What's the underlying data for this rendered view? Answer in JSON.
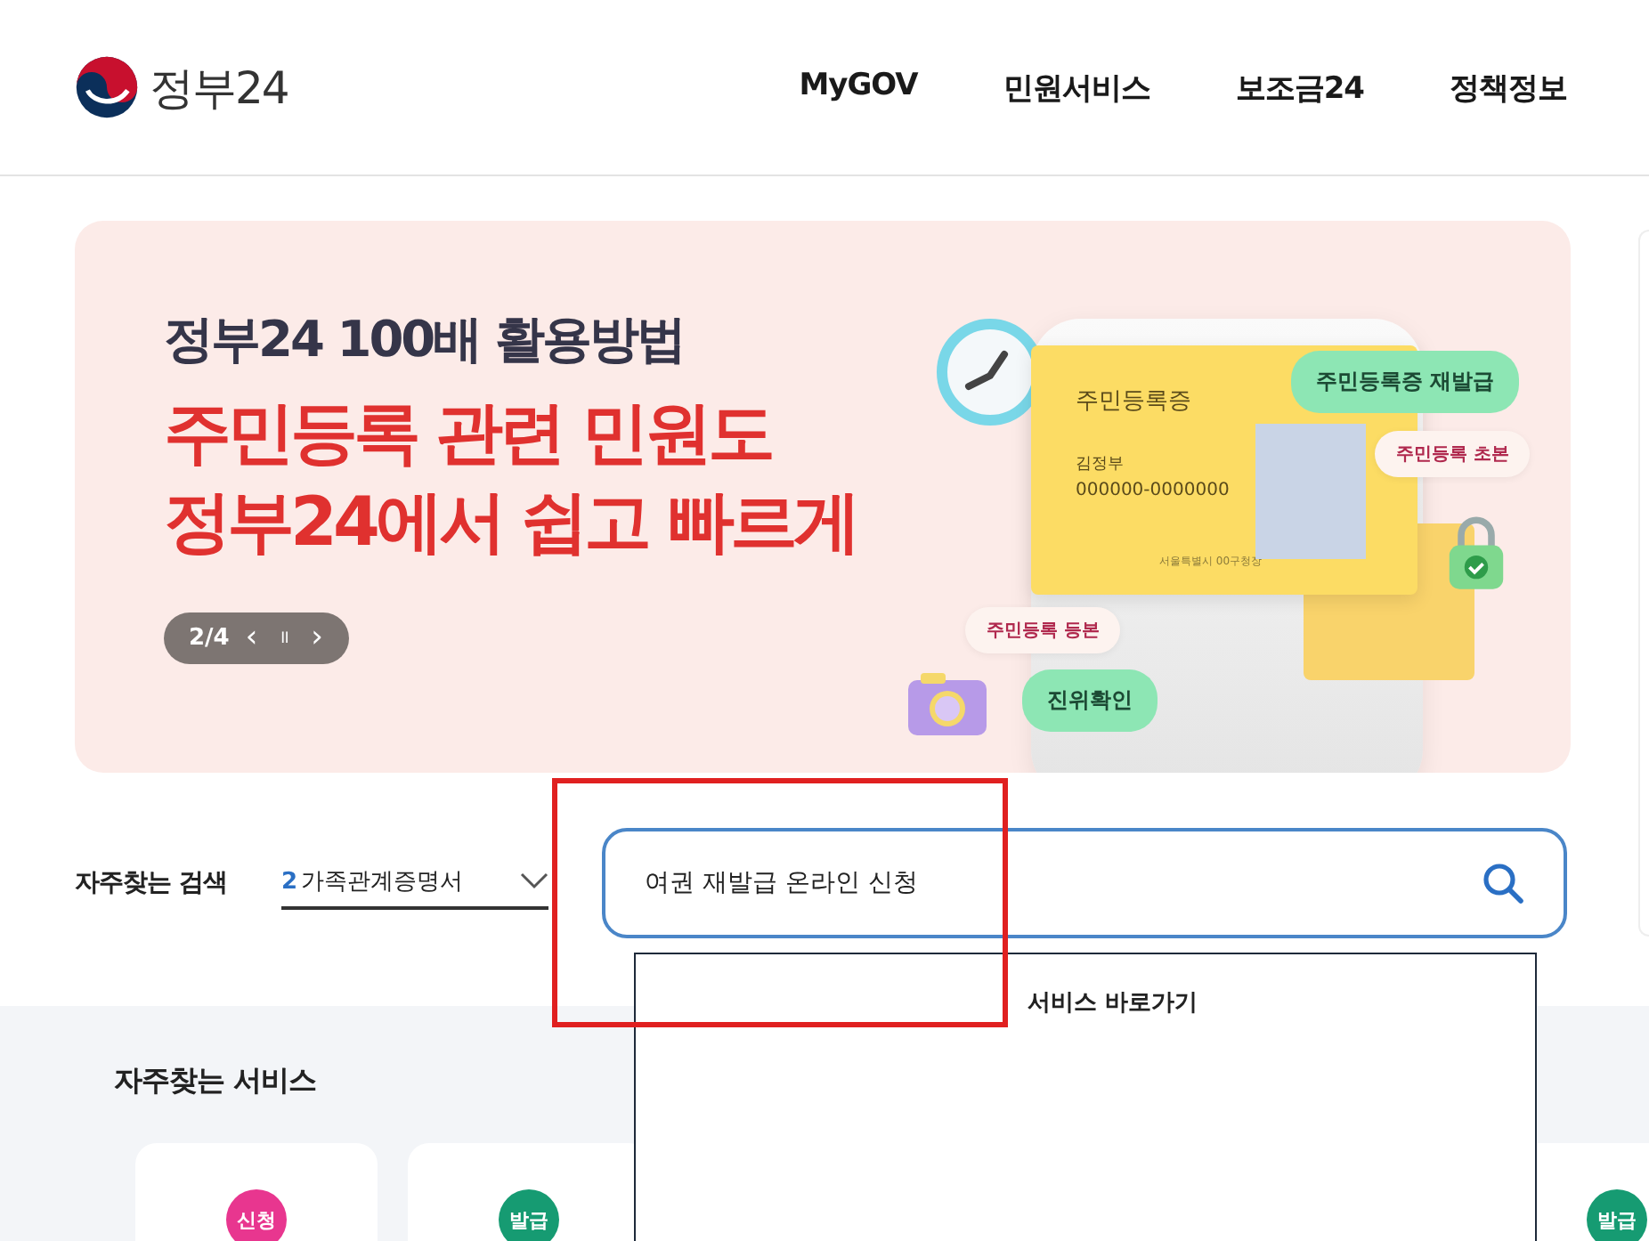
{
  "header": {
    "logo_text": "정부24",
    "nav": [
      {
        "label": "MyGOV"
      },
      {
        "label": "민원서비스"
      },
      {
        "label": "보조금24"
      },
      {
        "label": "정책정보"
      }
    ]
  },
  "banner": {
    "subtitle": "정부24 100배 활용방법",
    "headline_lines": [
      "주민등록 관련 민원도",
      "정부24에서 쉽고 빠르게"
    ],
    "pager": {
      "count": "2/4",
      "prev": "‹",
      "pause": "॥",
      "next": "›"
    },
    "card": {
      "title": "주민등록증",
      "name": "김정부",
      "number": "000000-0000000",
      "issuer": "서울특별시 00구청장"
    },
    "tags": [
      {
        "label": "주민등록증 재발급",
        "kind": "green"
      },
      {
        "label": "주민등록 초본",
        "kind": "light"
      },
      {
        "label": "주민등록 등본",
        "kind": "light"
      },
      {
        "label": "진위확인",
        "kind": "green"
      }
    ]
  },
  "search": {
    "label": "자주찾는 검색",
    "keyword_rank": "2",
    "keyword": "가족관계증명서",
    "value": "여권 재발급 온라인 신청",
    "dropdown_title": "서비스 바로가기"
  },
  "services": {
    "title": "자주찾는 서비스",
    "items": [
      {
        "badge": "신청",
        "color": "#e8368f"
      },
      {
        "badge": "발급",
        "color": "#169b72"
      },
      {
        "badge": "발급",
        "color": "#169b72"
      }
    ]
  }
}
